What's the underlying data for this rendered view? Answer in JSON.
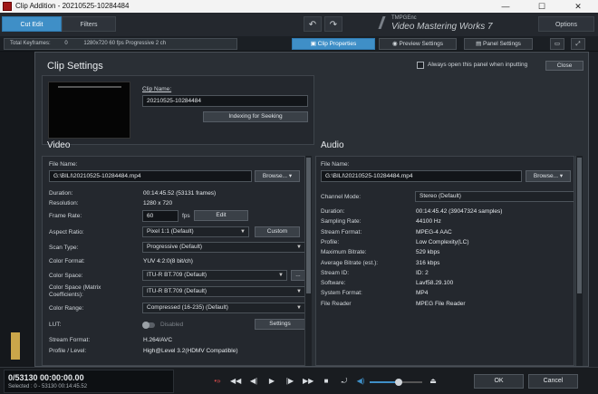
{
  "window": {
    "title": "Clip Addition - 20210525-10284484",
    "minimize": "—",
    "maximize": "☐",
    "close": "✕"
  },
  "tabs": [
    {
      "label": "Cut Edit",
      "active": true
    },
    {
      "label": "Filters",
      "active": false
    }
  ],
  "brand": {
    "small": "TMPGEnc",
    "name": "Video Mastering Works 7"
  },
  "options_label": "Options",
  "status": {
    "keyframes": "Total Keyframes:",
    "count": "0",
    "info": "1280x720  60 fps  Progressive  2 ch"
  },
  "subtabs": {
    "clip_properties": "Clip Properties",
    "preview_settings": "Preview Settings",
    "panel_settings": "Panel Settings"
  },
  "panel": {
    "title": "Clip Settings",
    "always_open": "Always open this panel when inputting",
    "close": "Close",
    "clip_name_label": "Clip Name:",
    "clip_name": "20210525-10284484",
    "indexing": "Indexing for Seeking"
  },
  "video": {
    "title": "Video",
    "file_name_label": "File Name:",
    "file_name": "G:\\BILI\\20210525-10284484.mp4",
    "browse": "Browse...",
    "duration_label": "Duration:",
    "duration": "00:14:45.52 (53131  frames)",
    "resolution_label": "Resolution:",
    "resolution": "1280 x 720",
    "frame_rate_label": "Frame Rate:",
    "frame_rate": "60",
    "fps": "fps",
    "edit": "Edit",
    "aspect_label": "Aspect Ratio:",
    "aspect": "Pixel 1:1 (Default)",
    "custom": "Custom",
    "scan_label": "Scan Type:",
    "scan": "Progressive (Default)",
    "color_format_label": "Color Format:",
    "color_format": "YUV 4:2:0(8 bit/ch)",
    "color_space_label": "Color Space:",
    "color_space": "ITU-R BT.709 (Default)",
    "dots": "...",
    "color_space_matrix_label": "Color Space (Matrix Coefficients):",
    "color_space_matrix": "ITU-R BT.709 (Default)",
    "color_range_label": "Color Range:",
    "color_range": "Compressed (16-235) (Default)",
    "lut_label": "LUT:",
    "lut_state": "Disabled",
    "settings": "Settings",
    "stream_format_label": "Stream Format:",
    "stream_format": "H.264/AVC",
    "profile_label": "Profile / Level:",
    "profile": "High@Level 3.2(HDMV Compatible)"
  },
  "audio": {
    "title": "Audio",
    "file_name_label": "File Name:",
    "file_name": "G:\\BILI\\20210525-10284484.mp4",
    "browse": "Browse...",
    "channel_label": "Channel Mode:",
    "channel": "Stereo (Default)",
    "rows": [
      {
        "label": "Duration:",
        "value": "00:14:45.42 (39047324  samples)"
      },
      {
        "label": "Sampling Rate:",
        "value": "44100 Hz"
      },
      {
        "label": "Stream Format:",
        "value": "MPEG-4 AAC"
      },
      {
        "label": "Profile:",
        "value": "Low Complexity(LC)"
      },
      {
        "label": "Maximum Bitrate:",
        "value": "529 kbps"
      },
      {
        "label": "Average Bitrate (est.):",
        "value": "316 kbps"
      },
      {
        "label": "Stream ID:",
        "value": "ID: 2"
      },
      {
        "label": "Software:",
        "value": "Lavf58.29.100"
      },
      {
        "label": "System Format:",
        "value": "MP4"
      },
      {
        "label": "File Reader",
        "value": "MPEG File Reader"
      }
    ]
  },
  "timecode": {
    "main": "0/53130   00:00:00.00",
    "sub": "Selected : 0 - 53130  00:14:45.52"
  },
  "volume": 0.55,
  "ok": "OK",
  "cancel": "Cancel",
  "colors": {
    "accent": "#3f8fc7",
    "background": "#1d2127",
    "panel": "#2a2f35"
  }
}
